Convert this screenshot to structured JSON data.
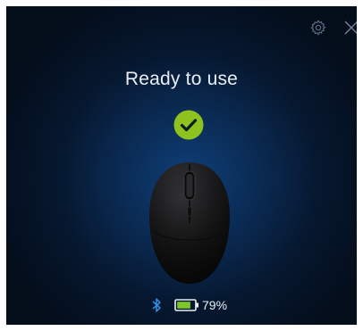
{
  "window": {
    "status_title": "Ready to use",
    "settings_icon": "gear-icon",
    "close_icon": "close-icon",
    "status_icon": "checkmark-circle-icon"
  },
  "device": {
    "image": "wireless-mouse-image",
    "connection_icon": "bluetooth-icon",
    "battery_icon": "battery-icon",
    "battery_level": 0.79,
    "battery_percent": "79%"
  },
  "colors": {
    "background_dark": "#040d1a",
    "background_glow": "#0e3f78",
    "check_green": "#8dc21f",
    "bluetooth_blue": "#2f8fe6",
    "battery_green": "#7cc72a",
    "text": "#e9eef5"
  }
}
